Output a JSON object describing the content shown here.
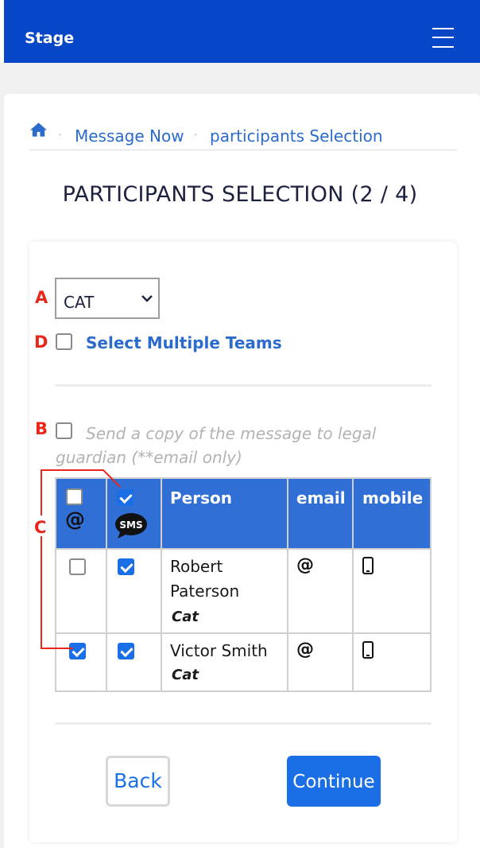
{
  "navbar": {
    "brand": "Stage",
    "menu_icon": "hamburger-menu-icon",
    "color": "#0747c7"
  },
  "breadcrumb": {
    "home_icon": "home-icon",
    "items": [
      "Message Now",
      "participants Selection"
    ],
    "separator": "·"
  },
  "page": {
    "title": "PARTICIPANTS SELECTION (2 / 4)"
  },
  "annotations": {
    "a": "A",
    "b": "B",
    "c": "C",
    "d": "D",
    "color": "#e8261a"
  },
  "team_select": {
    "value": "CAT"
  },
  "multi_teams": {
    "label": "Select Multiple Teams",
    "checked": false
  },
  "guardian": {
    "label": "Send a copy of the message to legal guardian (**email only)",
    "checked": false
  },
  "table": {
    "header_color": "#2f6fd6",
    "columns": [
      "Person",
      "email",
      "mobile"
    ],
    "select_all": {
      "email_checked": false,
      "sms_checked": true,
      "email_icon": "at-icon",
      "sms_icon": "sms-bubble-icon"
    },
    "rows": [
      {
        "name": "Robert Paterson",
        "team": "Cat",
        "email_checked": false,
        "sms_checked": true,
        "email_icon": "@",
        "mobile_icon": "phone-icon"
      },
      {
        "name": "Victor Smith",
        "team": "Cat",
        "email_checked": true,
        "sms_checked": true,
        "email_icon": "@",
        "mobile_icon": "phone-icon"
      }
    ]
  },
  "buttons": {
    "back": "Back",
    "continue": "Continue",
    "accent": "#1a6fe6"
  }
}
